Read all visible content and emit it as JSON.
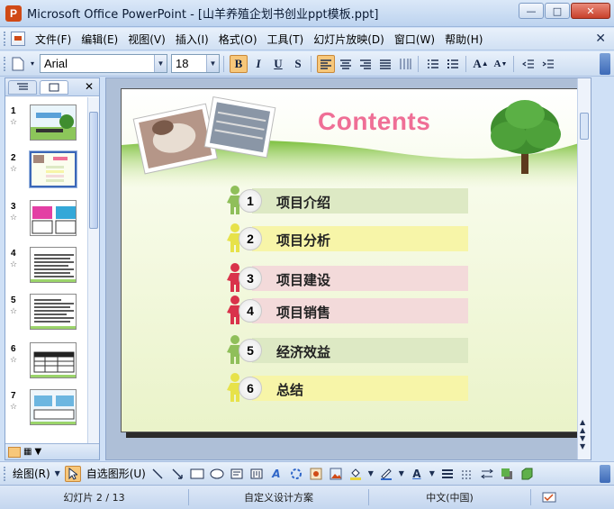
{
  "window": {
    "title": "Microsoft Office PowerPoint - [山羊养殖企划书创业ppt模板.ppt]"
  },
  "menu": {
    "items": [
      "文件(F)",
      "编辑(E)",
      "视图(V)",
      "插入(I)",
      "格式(O)",
      "工具(T)",
      "幻灯片放映(D)",
      "窗口(W)",
      "帮助(H)"
    ]
  },
  "toolbar": {
    "font_name": "Arial",
    "font_size": "18",
    "bold_label": "B",
    "italic_label": "I",
    "underline_label": "U",
    "shadow_label": "S"
  },
  "slides_panel": {
    "slide_numbers": [
      "1",
      "2",
      "3",
      "4",
      "5",
      "6",
      "7"
    ],
    "selected_index": 2
  },
  "slide": {
    "title": "Contents",
    "title_color": "#ef6f96",
    "items": [
      {
        "num": "1",
        "label": "项目介绍",
        "bar_color": "#dde9c4",
        "figure_color": "#8fbf5a"
      },
      {
        "num": "2",
        "label": "项目分析",
        "bar_color": "#f7f5a8",
        "figure_color": "#e7e24a"
      },
      {
        "num": "3",
        "label": "项目建设",
        "bar_color": "#f3dada",
        "figure_color": "#d9334b"
      },
      {
        "num": "4",
        "label": "项目销售",
        "bar_color": "#f3dada",
        "figure_color": "#d9334b"
      },
      {
        "num": "5",
        "label": "经济效益",
        "bar_color": "#dde9c4",
        "figure_color": "#8fbf5a"
      },
      {
        "num": "6",
        "label": "总结",
        "bar_color": "#f7f5a8",
        "figure_color": "#e7e24a"
      }
    ]
  },
  "drawing_toolbar": {
    "draw_label": "绘图(R)",
    "autoshapes_label": "自选图形(U)"
  },
  "status": {
    "slide_info": "幻灯片 2 / 13",
    "design": "自定义设计方案",
    "language": "中文(中国)"
  },
  "colors": {
    "accent": "#3b67b8",
    "active_button": "#f7c77a"
  }
}
